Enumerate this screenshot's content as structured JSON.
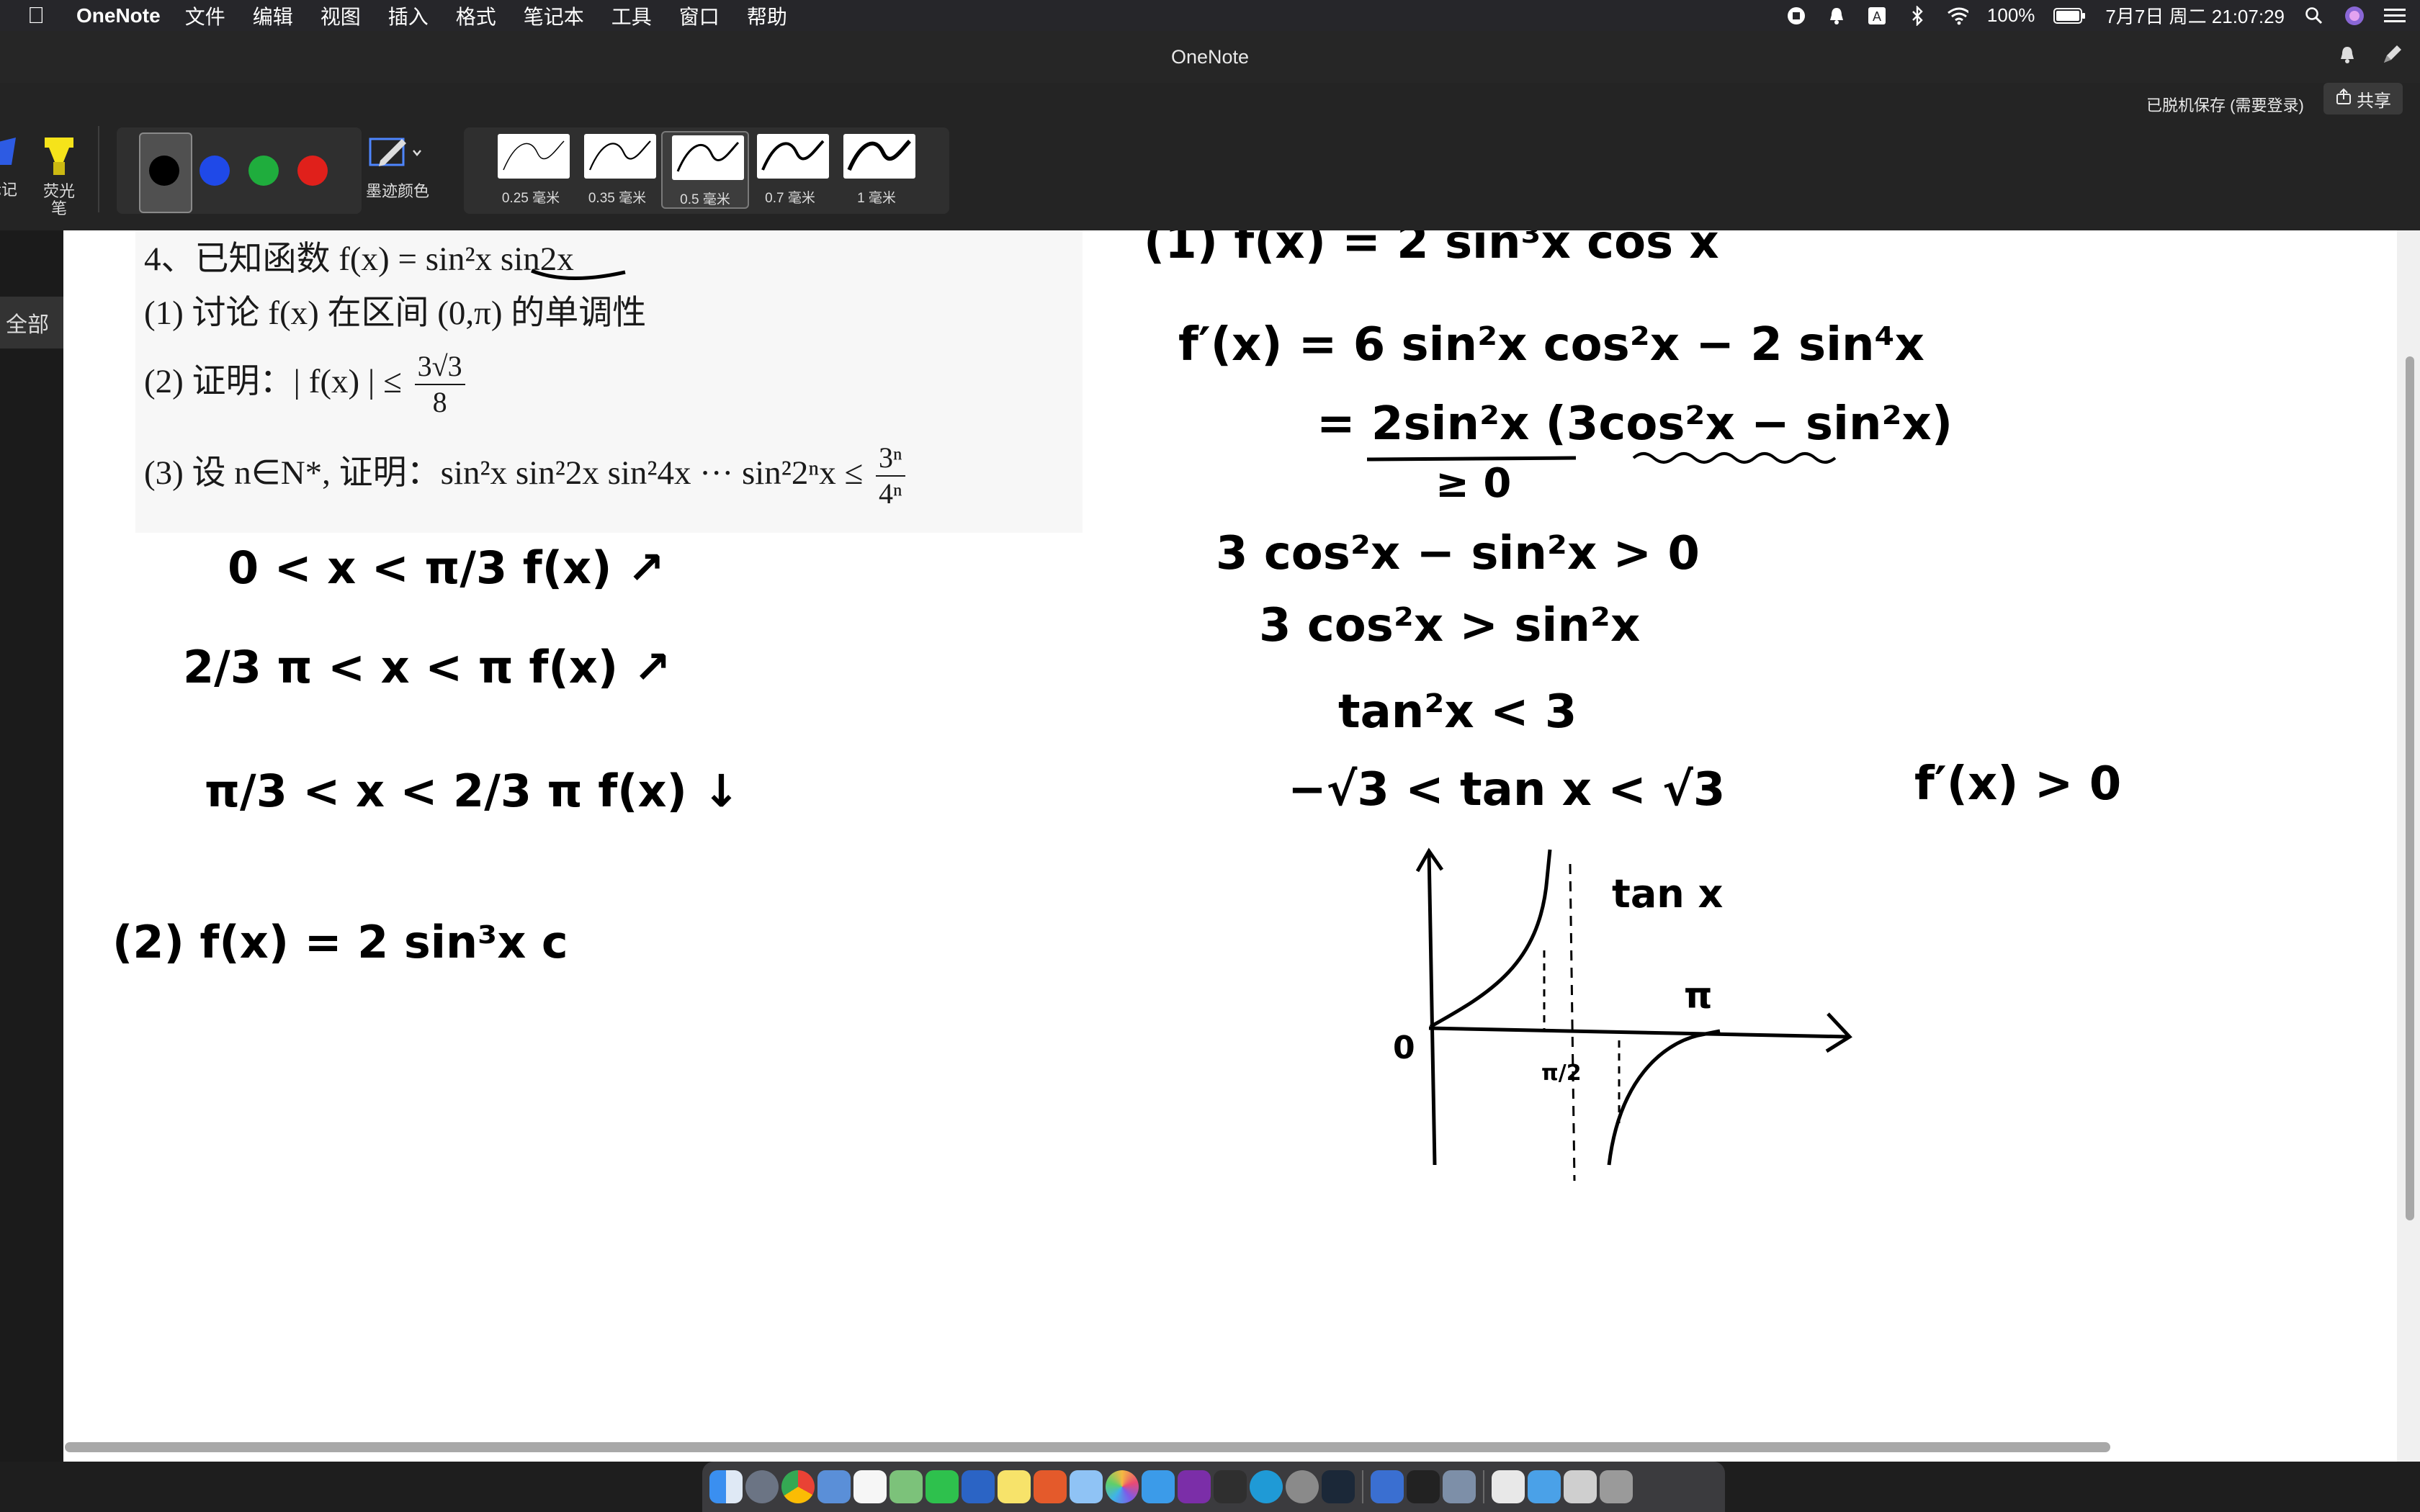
{
  "menubar": {
    "app_name": "OneNote",
    "items": [
      "文件",
      "编辑",
      "视图",
      "插入",
      "格式",
      "笔记本",
      "工具",
      "窗口",
      "帮助"
    ],
    "battery": "100%",
    "datetime": "7月7日 周二 21:07:29"
  },
  "window": {
    "title": "OneNote"
  },
  "ribbon": {
    "save_status": "已脱机保存 (需要登录)",
    "share_label": "共享",
    "left_tool_partial": "标记",
    "highlighter_label": "荧光\n笔",
    "ink_color_label": "墨迹颜色",
    "colors": [
      {
        "name": "black",
        "hex": "#000000",
        "selected": true
      },
      {
        "name": "blue",
        "hex": "#1f49e8",
        "selected": false
      },
      {
        "name": "green",
        "hex": "#1fad3d",
        "selected": false
      },
      {
        "name": "red",
        "hex": "#e0201b",
        "selected": false
      }
    ],
    "thickness": [
      {
        "label": "0.25 毫米",
        "selected": false
      },
      {
        "label": "0.35 毫米",
        "selected": false
      },
      {
        "label": "0.5 毫米",
        "selected": true
      },
      {
        "label": "0.7 毫米",
        "selected": false
      },
      {
        "label": "1 毫米",
        "selected": false
      }
    ]
  },
  "sidebar": {
    "tab_label": "全部"
  },
  "problem": {
    "line1": "4、已知函数 f(x) = sin²x sin2x",
    "line2": "(1) 讨论 f(x) 在区间 (0,π) 的单调性",
    "line3_prefix": "(2) 证明：| f(x) | ≤",
    "line3_num": "3√3",
    "line3_den": "8",
    "line4_prefix": "(3) 设 n∈N*, 证明：sin²x sin²2x sin²4x ··· sin²2ⁿx ≤",
    "line4_num": "3ⁿ",
    "line4_den": "4ⁿ"
  },
  "ink_notes": {
    "left": [
      "0 < x < π/3      f(x) ↗",
      "2/3 π < x < π     f(x) ↗",
      "π/3 < x < 2/3 π      f(x) ↓",
      "(2)   f(x) = 2 sin³x  c"
    ],
    "right": [
      "(1)  f(x) = 2 sin³x cos x",
      "f′(x) = 6 sin²x cos²x − 2 sin⁴x",
      "= 2sin²x (3cos²x − sin²x)",
      "≥ 0",
      "3 cos²x − sin²x > 0",
      "3 cos²x > sin²x",
      "tan²x < 3",
      "−√3 < tan x < √3",
      "f′(x) > 0",
      "tan x",
      "π",
      "0",
      "π/2"
    ]
  }
}
